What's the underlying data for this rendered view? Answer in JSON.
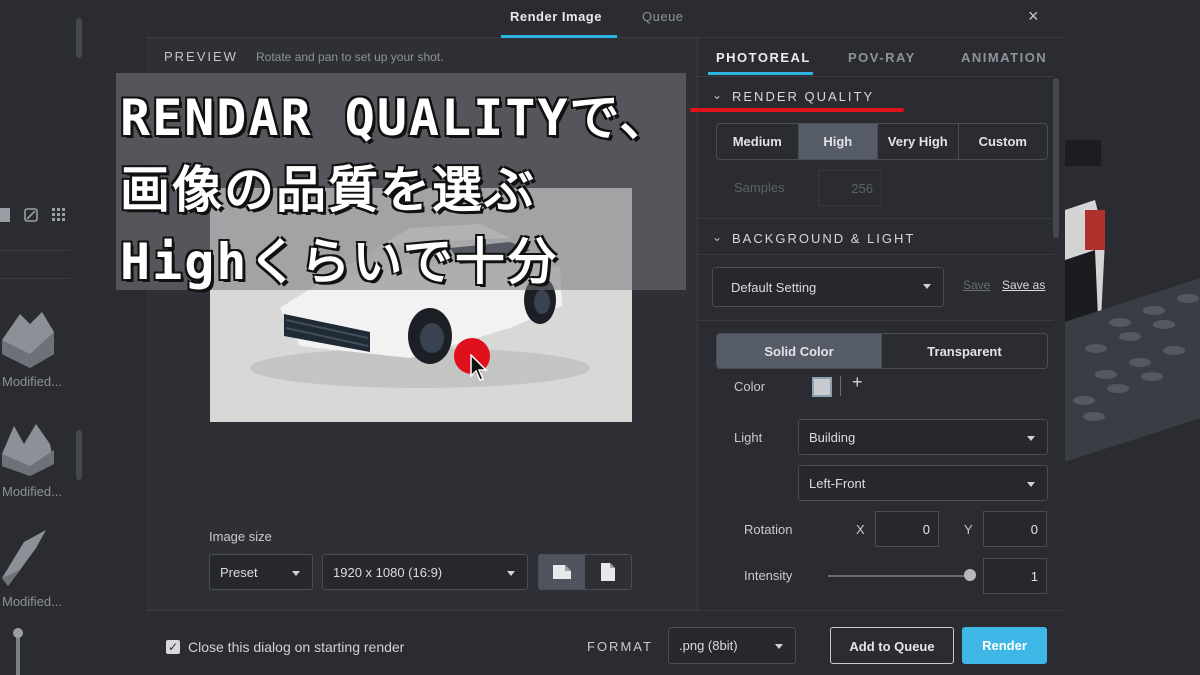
{
  "dialog": {
    "tabs": [
      "Render Image",
      "Queue"
    ],
    "close_label": "×"
  },
  "preview": {
    "label": "PREVIEW",
    "hint": "Rotate and pan to set up your shot."
  },
  "image_size": {
    "label": "Image size",
    "preset": "Preset",
    "resolution": "1920 x 1080 (16:9)"
  },
  "panel": {
    "tabs": [
      "PHOTOREAL",
      "POV-RAY",
      "ANIMATION"
    ],
    "render_quality": {
      "title": "RENDER QUALITY",
      "options": [
        "Medium",
        "High",
        "Very High",
        "Custom"
      ],
      "selected": "High",
      "samples_label": "Samples",
      "samples_value": "256"
    },
    "background_light": {
      "title": "BACKGROUND & LIGHT",
      "preset": "Default Setting",
      "save": "Save",
      "save_as": "Save as",
      "bg_options": [
        "Solid Color",
        "Transparent"
      ],
      "color_label": "Color",
      "light_label": "Light",
      "light_value": "Building",
      "direction_value": "Left-Front",
      "rotation_label": "Rotation",
      "x_label": "X",
      "x_value": "0",
      "y_label": "Y",
      "y_value": "0",
      "intensity_label": "Intensity",
      "intensity_value": "1",
      "intensity_level": 1.0
    }
  },
  "footer": {
    "close_on_render": "Close this dialog on starting render",
    "format_label": "FORMAT",
    "format_value": ".png (8bit)",
    "add_to_queue": "Add to Queue",
    "render": "Render"
  },
  "sidebar": {
    "parts": [
      "Modified...",
      "Modified...",
      "Modified..."
    ]
  },
  "caption": {
    "lines": [
      "RENDAR QUALITYで、",
      "画像の品質を選ぶ",
      "Highくらいで十分"
    ]
  },
  "colors": {
    "accent": "#3fb7e6",
    "annotation_red": "#e0121a"
  }
}
